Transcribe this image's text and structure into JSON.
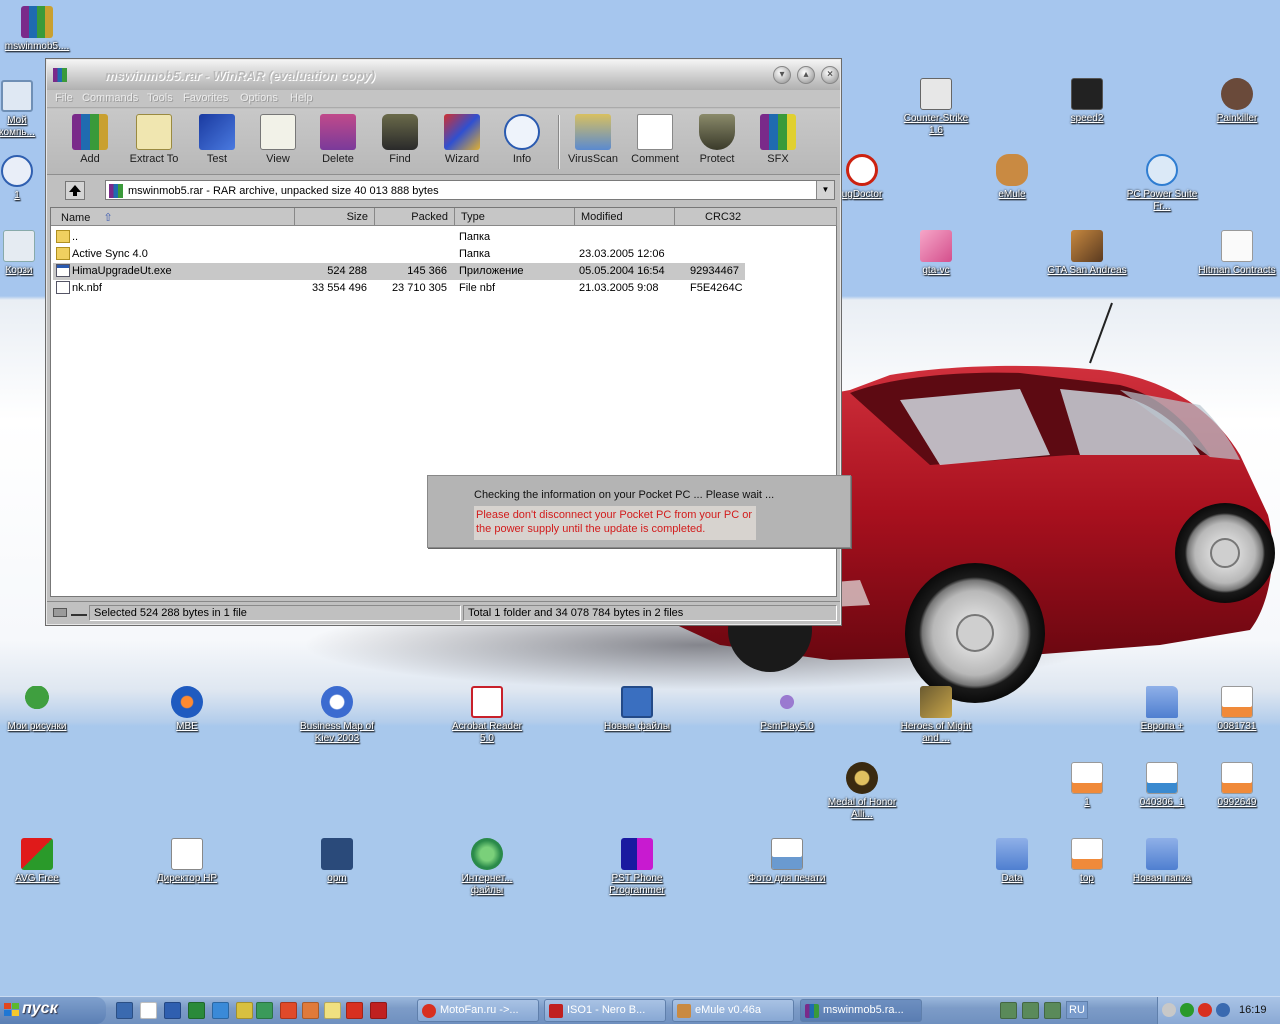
{
  "colors": {
    "desktop": "#a8c8ec",
    "taskbar": "#7d9cc8",
    "car": "#a8101e",
    "dialog_warning": "#d21c1c"
  },
  "desktop": {
    "icons": [
      {
        "id": "mswinmob5",
        "label": "mswinmob5....",
        "icon": "winrar-archive-icon"
      },
      {
        "id": "my-computer",
        "label": "Мой компь...",
        "icon": "computer-icon"
      },
      {
        "id": "word-partial",
        "label": "1",
        "icon": "word-icon"
      },
      {
        "id": "recycle-partial",
        "label": "Корзи",
        "icon": "recycle-bin-icon"
      },
      {
        "id": "counter-strike",
        "label": "Counter-Strike 1.6",
        "icon": "counter-strike-icon"
      },
      {
        "id": "speed2",
        "label": "speed2",
        "icon": "nfs-icon"
      },
      {
        "id": "painkiller",
        "label": "Painkiller",
        "icon": "painkiller-icon"
      },
      {
        "id": "ugdoctor",
        "label": "ugDoctor",
        "icon": "ugdoctor-icon"
      },
      {
        "id": "emule",
        "label": "eMule",
        "icon": "emule-icon"
      },
      {
        "id": "pc-power-suite",
        "label": "PC Power Suite Fr...",
        "icon": "ie-icon"
      },
      {
        "id": "gta-vc",
        "label": "gta-vc",
        "icon": "gta-vc-icon"
      },
      {
        "id": "gta-sa",
        "label": "GTA San Andreas",
        "icon": "gta-sa-icon"
      },
      {
        "id": "hitman",
        "label": "Hitman Contracts",
        "icon": "hitman-icon"
      },
      {
        "id": "my-pictures",
        "label": "Мои рисунки",
        "icon": "tree-icon"
      },
      {
        "id": "mbe",
        "label": "MBE",
        "icon": "mbe-icon"
      },
      {
        "id": "business-map",
        "label": "Business Map of Kiev 2003",
        "icon": "map-icon"
      },
      {
        "id": "acrobat",
        "label": "Acrobat Reader 5.0",
        "icon": "acrobat-icon"
      },
      {
        "id": "new-files",
        "label": "Новые файлы",
        "icon": "floppy-icon"
      },
      {
        "id": "psmplay",
        "label": "PsmPlay5.0",
        "icon": "music-icon"
      },
      {
        "id": "heroes",
        "label": "Heroes of Might and ...",
        "icon": "heroes-icon"
      },
      {
        "id": "europe",
        "label": "Европа +",
        "icon": "folder-icon"
      },
      {
        "id": "img-0081731",
        "label": "0081731",
        "icon": "image-file-icon"
      },
      {
        "id": "medal-honor",
        "label": "Medal of Honor Alli...",
        "icon": "medal-icon"
      },
      {
        "id": "img-1",
        "label": "1",
        "icon": "image-file-icon"
      },
      {
        "id": "img-040306",
        "label": "040306_1",
        "icon": "image-file-icon"
      },
      {
        "id": "img-0992649",
        "label": "0992649",
        "icon": "image-file-icon"
      },
      {
        "id": "avg",
        "label": "AVG Free",
        "icon": "avg-icon"
      },
      {
        "id": "director-hp",
        "label": "Директор HP",
        "icon": "hp-director-icon"
      },
      {
        "id": "opm",
        "label": "opm",
        "icon": "opm-icon"
      },
      {
        "id": "internet-files",
        "label": "Интернет... файлы",
        "icon": "globe-icon"
      },
      {
        "id": "pst-phone",
        "label": "PST Phone Programmer",
        "icon": "pst-icon"
      },
      {
        "id": "photo-print",
        "label": "Фото для печати",
        "icon": "photo-doc-icon"
      },
      {
        "id": "data",
        "label": "Data",
        "icon": "folder-icon"
      },
      {
        "id": "top",
        "label": "top",
        "icon": "image-file-icon"
      },
      {
        "id": "new-folder",
        "label": "Новая папка",
        "icon": "folder-icon"
      }
    ]
  },
  "winrar": {
    "title": "mswinmob5.rar - WinRAR (evaluation copy)",
    "menu": [
      "File",
      "Commands",
      "Tools",
      "Favorites",
      "Options",
      "Help"
    ],
    "toolbar": [
      {
        "label": "Add",
        "icon": "add-archive-icon"
      },
      {
        "label": "Extract To",
        "icon": "extract-icon"
      },
      {
        "label": "Test",
        "icon": "test-icon"
      },
      {
        "label": "View",
        "icon": "view-icon"
      },
      {
        "label": "Delete",
        "icon": "delete-icon"
      },
      {
        "label": "Find",
        "icon": "find-icon"
      },
      {
        "label": "Wizard",
        "icon": "wizard-icon"
      },
      {
        "label": "Info",
        "icon": "info-icon"
      },
      {
        "label": "VirusScan",
        "icon": "virusscan-icon"
      },
      {
        "label": "Comment",
        "icon": "comment-icon"
      },
      {
        "label": "Protect",
        "icon": "protect-icon"
      },
      {
        "label": "SFX",
        "icon": "sfx-icon"
      }
    ],
    "address": "mswinmob5.rar - RAR archive, unpacked size 40 013 888 bytes",
    "columns": [
      "Name",
      "Size",
      "Packed",
      "Type",
      "Modified",
      "CRC32"
    ],
    "rows": [
      {
        "name": "..",
        "size": "",
        "packed": "",
        "type": "Папка",
        "modified": "",
        "crc": "",
        "icon": "folder-icon",
        "selected": false
      },
      {
        "name": "Active Sync 4.0",
        "size": "",
        "packed": "",
        "type": "Папка",
        "modified": "23.03.2005 12:06",
        "crc": "",
        "icon": "folder-icon",
        "selected": false
      },
      {
        "name": "HimaUpgradeUt.exe",
        "size": "524 288",
        "packed": "145 366",
        "type": "Приложение",
        "modified": "05.05.2004 16:54",
        "crc": "92934467",
        "icon": "exe-icon",
        "selected": true
      },
      {
        "name": "nk.nbf",
        "size": "33 554 496",
        "packed": "23 710 305",
        "type": "File nbf",
        "modified": "21.03.2005 9:08",
        "crc": "F5E4264C",
        "icon": "file-icon",
        "selected": false
      }
    ],
    "status_left": "Selected 524 288 bytes in 1 file",
    "status_right": "Total 1 folder and 34 078 784 bytes in 2 files"
  },
  "dialog": {
    "line1": "Checking the information on your Pocket PC ... Please wait ...",
    "warning": "Please don't disconnect your Pocket PC from your PC or the power supply until the update is completed."
  },
  "taskbar": {
    "start_label": "пуск",
    "quick_launch": [
      "desktop-icon",
      "media-player-icon",
      "word-icon",
      "excel-icon",
      "ie-icon",
      "acrobat-icon",
      "ps-icon",
      "opera-icon",
      "outlook-icon",
      "clock-icon",
      "nero-icon",
      "opera-red-icon"
    ],
    "tasks": [
      {
        "label": "MotoFan.ru ->...",
        "icon": "opera-icon",
        "active": false
      },
      {
        "label": "ISO1 - Nero B...",
        "icon": "nero-icon",
        "active": false
      },
      {
        "label": "eMule v0.46a",
        "icon": "emule-icon",
        "active": false
      },
      {
        "label": "mswinmob5.ra...",
        "icon": "winrar-icon",
        "active": true
      }
    ],
    "language": "RU",
    "clock": "16:19"
  }
}
